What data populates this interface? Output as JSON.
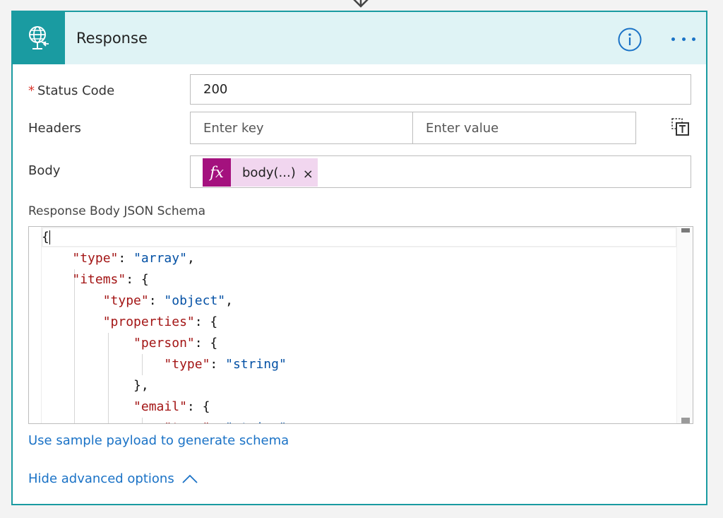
{
  "card": {
    "title": "Response",
    "icon": "globe-request-icon",
    "accent_color": "#1a9ba1",
    "header_bg": "#dff3f5"
  },
  "fields": {
    "status_code": {
      "label": "Status Code",
      "required_marker": "*",
      "value": "200"
    },
    "headers": {
      "label": "Headers",
      "key_placeholder": "Enter key",
      "value_placeholder": "Enter value"
    },
    "body": {
      "label": "Body",
      "token_icon": "fx",
      "token_label": "body(...)",
      "token_remove": "×",
      "token_color": "#a4117e"
    }
  },
  "schema": {
    "label": "Response Body JSON Schema",
    "lines": [
      [
        {
          "t": "p",
          "v": "{"
        }
      ],
      [
        {
          "t": "p",
          "v": "    "
        },
        {
          "t": "k",
          "v": "\"type\""
        },
        {
          "t": "p",
          "v": ": "
        },
        {
          "t": "s",
          "v": "\"array\""
        },
        {
          "t": "p",
          "v": ","
        }
      ],
      [
        {
          "t": "p",
          "v": "    "
        },
        {
          "t": "k",
          "v": "\"items\""
        },
        {
          "t": "p",
          "v": ": {"
        }
      ],
      [
        {
          "t": "p",
          "v": "        "
        },
        {
          "t": "k",
          "v": "\"type\""
        },
        {
          "t": "p",
          "v": ": "
        },
        {
          "t": "s",
          "v": "\"object\""
        },
        {
          "t": "p",
          "v": ","
        }
      ],
      [
        {
          "t": "p",
          "v": "        "
        },
        {
          "t": "k",
          "v": "\"properties\""
        },
        {
          "t": "p",
          "v": ": {"
        }
      ],
      [
        {
          "t": "p",
          "v": "            "
        },
        {
          "t": "k",
          "v": "\"person\""
        },
        {
          "t": "p",
          "v": ": {"
        }
      ],
      [
        {
          "t": "p",
          "v": "                "
        },
        {
          "t": "k",
          "v": "\"type\""
        },
        {
          "t": "p",
          "v": ": "
        },
        {
          "t": "s",
          "v": "\"string\""
        }
      ],
      [
        {
          "t": "p",
          "v": "            },"
        }
      ],
      [
        {
          "t": "p",
          "v": "            "
        },
        {
          "t": "k",
          "v": "\"email\""
        },
        {
          "t": "p",
          "v": ": {"
        }
      ],
      [
        {
          "t": "p",
          "v": "                "
        },
        {
          "t": "k",
          "v": "\"type\""
        },
        {
          "t": "p",
          "v": ": "
        },
        {
          "t": "s",
          "v": "\"string\""
        }
      ]
    ]
  },
  "links": {
    "sample_payload": "Use sample payload to generate schema",
    "advanced": "Hide advanced options"
  }
}
